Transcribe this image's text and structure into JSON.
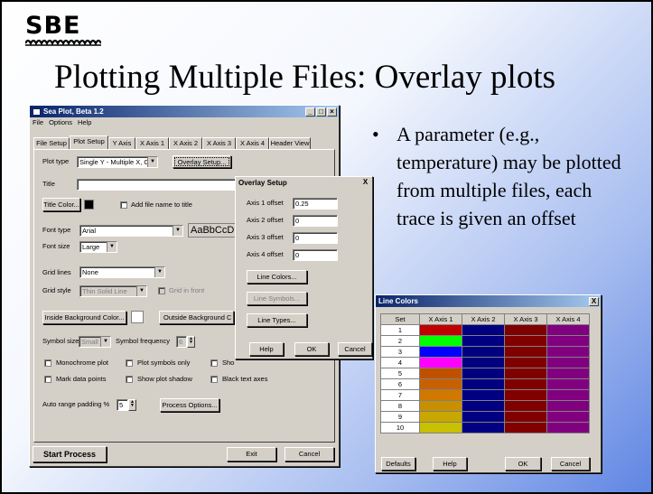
{
  "logo": {
    "text": "SBE"
  },
  "slide": {
    "title": "Plotting Multiple Files: Overlay plots",
    "bullet": "A parameter (e.g., temperature) may be plotted from multiple files, each trace is given an offset"
  },
  "main_window": {
    "title": "Sea Plot, Beta 1.2",
    "menu": [
      "File",
      "Options",
      "Help"
    ],
    "tabs": [
      "File Setup",
      "Plot Setup",
      "Y Axis",
      "X Axis 1",
      "X Axis 2",
      "X Axis 3",
      "X Axis 4",
      "Header View"
    ],
    "plot_type_label": "Plot type",
    "plot_type_value": "Single Y - Multiple X, Overlay",
    "overlay_setup_button": "Overlay Setup...",
    "title_label": "Title",
    "title_value": "",
    "title_color_button": "Title Color...",
    "add_file_name_label": "Add file name to title",
    "font_type_label": "Font type",
    "font_type_value": "Arial",
    "font_preview": "AaBbCcD",
    "font_size_label": "Font size",
    "font_size_value": "Large",
    "grid_lines_label": "Grid lines",
    "grid_lines_value": "None",
    "grid_style_label": "Grid style",
    "grid_style_value": "Thin Solid Line",
    "grid_in_front_label": "Grid in front",
    "inside_bg_button": "Inside Background Color...",
    "outside_bg_button": "Outside Background C",
    "symbol_size_label": "Symbol size",
    "symbol_size_value": "Small",
    "symbol_frequency_label": "Symbol frequency",
    "symbol_frequency_value": "6",
    "monochrome_label": "Monochrome plot",
    "plot_symbols_only_label": "Plot symbols only",
    "sho_label": "Sho",
    "mark_data_points_label": "Mark data points",
    "show_plot_shadow_label": "Show plot shadow",
    "black_text_axes_label": "Black text axes",
    "auto_range_label": "Auto range padding %",
    "auto_range_value": "5",
    "process_options_button": "Process Options...",
    "start_process_button": "Start Process",
    "exit_button": "Exit",
    "cancel_button": "Cancel"
  },
  "overlay_dialog": {
    "title": "Overlay Setup",
    "close": "X",
    "axis_offsets": [
      {
        "label": "Axis 1 offset",
        "value": "0.25"
      },
      {
        "label": "Axis 2 offset",
        "value": "0"
      },
      {
        "label": "Axis 3 offset",
        "value": "0"
      },
      {
        "label": "Axis 4 offset",
        "value": "0"
      }
    ],
    "line_colors_button": "Line Colors...",
    "line_symbols_button": "Line Symbols...",
    "line_types_button": "Line Types...",
    "help_button": "Help",
    "ok_button": "OK",
    "cancel_button": "Cancel"
  },
  "line_colors_dialog": {
    "title": "Line Colors",
    "close": "X",
    "headers": [
      "Set",
      "X Axis 1",
      "X Axis 2",
      "X Axis 3",
      "X Axis 4"
    ],
    "rows": [
      {
        "set": "1",
        "colors": [
          "#c00000",
          "#000080",
          "#800000",
          "#800080"
        ]
      },
      {
        "set": "2",
        "colors": [
          "#00ff00",
          "#000080",
          "#800000",
          "#800080"
        ]
      },
      {
        "set": "3",
        "colors": [
          "#0000ff",
          "#000080",
          "#800000",
          "#800080"
        ]
      },
      {
        "set": "4",
        "colors": [
          "#ff00ff",
          "#000080",
          "#800000",
          "#800080"
        ]
      },
      {
        "set": "5",
        "colors": [
          "#c05000",
          "#000080",
          "#800000",
          "#800080"
        ]
      },
      {
        "set": "6",
        "colors": [
          "#c86000",
          "#000080",
          "#800000",
          "#800080"
        ]
      },
      {
        "set": "7",
        "colors": [
          "#d07800",
          "#000080",
          "#800000",
          "#800080"
        ]
      },
      {
        "set": "8",
        "colors": [
          "#c89000",
          "#000080",
          "#800000",
          "#800080"
        ]
      },
      {
        "set": "9",
        "colors": [
          "#c8a800",
          "#000080",
          "#800000",
          "#800080"
        ]
      },
      {
        "set": "10",
        "colors": [
          "#c8c000",
          "#000080",
          "#800000",
          "#800080"
        ]
      }
    ],
    "defaults_button": "Defaults",
    "help_button": "Help",
    "ok_button": "OK",
    "cancel_button": "Cancel"
  }
}
